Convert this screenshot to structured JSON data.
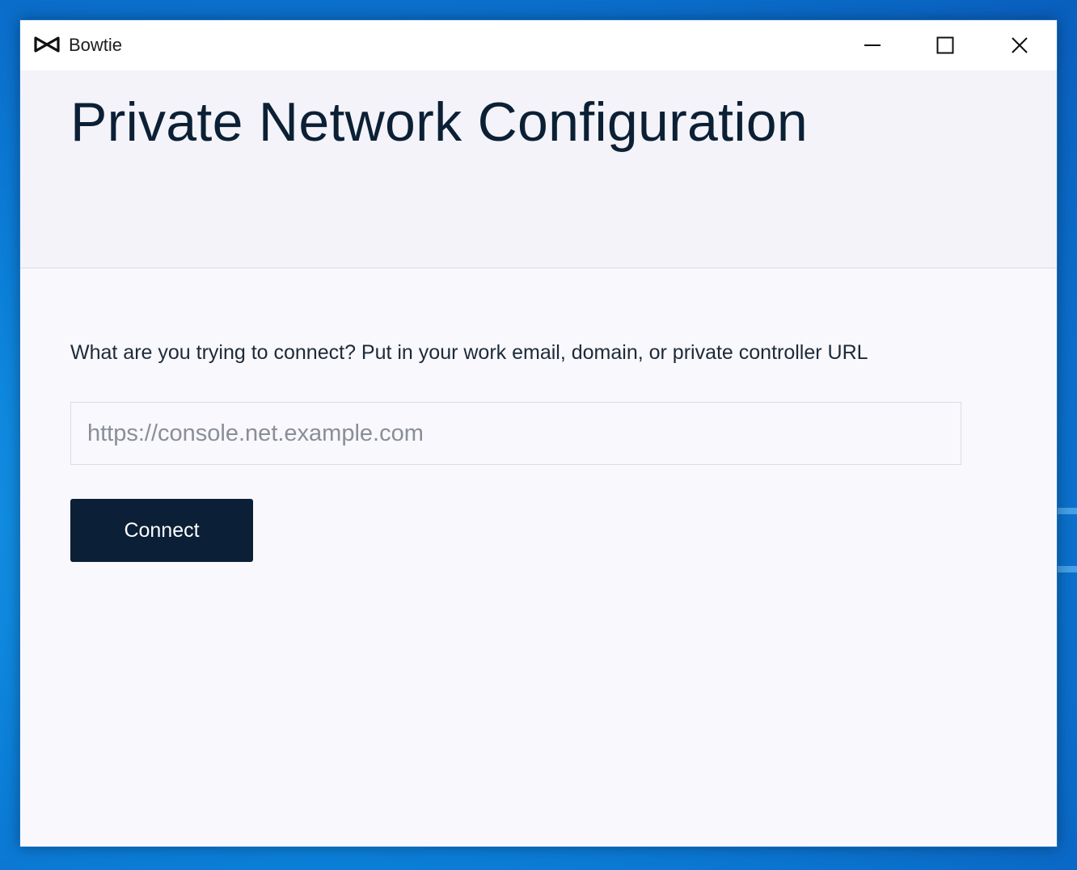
{
  "window": {
    "app_title": "Bowtie",
    "logo_icon": "bowtie-icon",
    "controls": {
      "minimize_icon": "minimize-icon",
      "maximize_icon": "maximize-icon",
      "close_icon": "close-icon"
    }
  },
  "main": {
    "title": "Private Network Configuration",
    "prompt": "What are you trying to connect? Put in your work email, domain, or private controller URL",
    "url_input": {
      "value": "",
      "placeholder": "https://console.net.example.com"
    },
    "connect_label": "Connect"
  },
  "colors": {
    "header_band": "#f3f3f9",
    "content_bg": "#f8f8fd",
    "title_text": "#0c2035",
    "button_bg": "#0b1f36",
    "button_text": "#ffffff"
  }
}
